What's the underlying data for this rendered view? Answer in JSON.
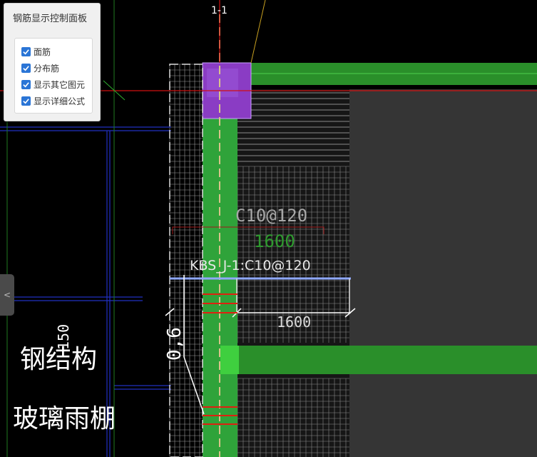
{
  "panel": {
    "title": "钢筋显示控制面板",
    "options": [
      {
        "label": "面筋",
        "checked": true
      },
      {
        "label": "分布筋",
        "checked": true
      },
      {
        "label": "显示其它图元",
        "checked": true
      },
      {
        "label": "显示详细公式",
        "checked": true
      }
    ]
  },
  "collapse_tab": {
    "glyph": "<"
  },
  "drawing": {
    "section_label": "1-1",
    "rebar_spec": "C10@120",
    "rebar_length": "1600",
    "member_label": "KBS_J-1:C10@120",
    "dimension_value": "1600",
    "vertical_dimension": "0,6",
    "small_dimension": "150",
    "text_steel_structure": "钢结构",
    "text_glass_canopy": "玻璃雨棚"
  },
  "colors": {
    "background": "#000000",
    "green_beam": "#2a8f2a",
    "column_purple": "#8a3cc4",
    "axis_red": "#d01010",
    "rebar_red": "#e02010",
    "blue_line": "#2030c0",
    "checkbox_blue": "#2a75d6"
  }
}
